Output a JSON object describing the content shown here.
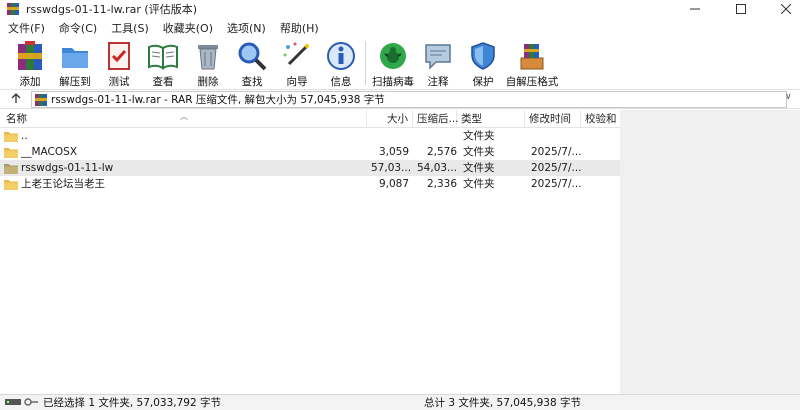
{
  "window": {
    "title": "rsswdgs-01-11-lw.rar (评估版本)",
    "controls": {
      "minimize": "—",
      "maximize": "☐",
      "close": "✕"
    }
  },
  "menu": [
    {
      "label": "文件(F)"
    },
    {
      "label": "命令(C)"
    },
    {
      "label": "工具(S)"
    },
    {
      "label": "收藏夹(O)"
    },
    {
      "label": "选项(N)"
    },
    {
      "label": "帮助(H)"
    }
  ],
  "toolbar": [
    {
      "label": "添加",
      "icon": "add-archive-icon"
    },
    {
      "label": "解压到",
      "icon": "extract-to-icon"
    },
    {
      "label": "测试",
      "icon": "test-icon"
    },
    {
      "label": "查看",
      "icon": "view-icon"
    },
    {
      "label": "删除",
      "icon": "delete-icon"
    },
    {
      "label": "查找",
      "icon": "find-icon"
    },
    {
      "label": "向导",
      "icon": "wizard-icon"
    },
    {
      "label": "信息",
      "icon": "info-icon"
    },
    {
      "label": "扫描病毒",
      "icon": "virus-scan-icon"
    },
    {
      "label": "注释",
      "icon": "comment-icon"
    },
    {
      "label": "保护",
      "icon": "protect-icon"
    },
    {
      "label": "自解压格式",
      "icon": "sfx-icon"
    }
  ],
  "address": {
    "text": "rsswdgs-01-11-lw.rar - RAR 压缩文件, 解包大小为 57,045,938 字节",
    "up_icon": "up-arrow-icon",
    "dropdown": "∨"
  },
  "columns": {
    "name": "名称",
    "size": "大小",
    "packed": "压缩后...",
    "type": "类型",
    "modified": "修改时间",
    "crc": "校验和"
  },
  "files": [
    {
      "name": "..",
      "size": "",
      "packed": "",
      "type": "文件夹",
      "modified": "",
      "selected": false,
      "icon": "folder-icon"
    },
    {
      "name": "__MACOSX",
      "size": "3,059",
      "packed": "2,576",
      "type": "文件夹",
      "modified": "2025/7/...",
      "selected": false,
      "icon": "folder-icon"
    },
    {
      "name": "rsswdgs-01-11-lw",
      "size": "57,03...",
      "packed": "54,03...",
      "type": "文件夹",
      "modified": "2025/7/...",
      "selected": true,
      "icon": "folder-icon"
    },
    {
      "name": "上老王论坛当老王",
      "size": "9,087",
      "packed": "2,336",
      "type": "文件夹",
      "modified": "2025/7/...",
      "selected": false,
      "icon": "folder-icon"
    }
  ],
  "status": {
    "left": "已经选择 1 文件夹, 57,033,792 字节",
    "right": "总计 3 文件夹, 57,045,938 字节"
  },
  "colors": {
    "folder": "#e8b84a",
    "selected_row": "#e9e9e9",
    "accent_blue": "#2f6fd1"
  }
}
